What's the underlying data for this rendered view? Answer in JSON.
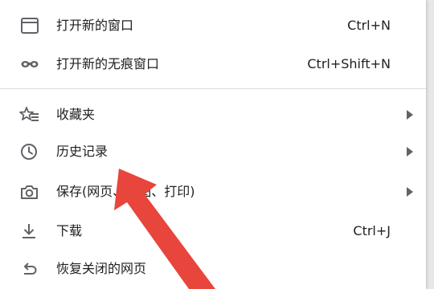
{
  "menu": {
    "items": [
      {
        "label": "打开新的窗口",
        "shortcut": "Ctrl+N",
        "icon": "new-window-icon"
      },
      {
        "label": "打开新的无痕窗口",
        "shortcut": "Ctrl+Shift+N",
        "icon": "incognito-icon"
      },
      {
        "label": "收藏夹",
        "icon": "bookmarks-star-icon",
        "submenu": true
      },
      {
        "label": "历史记录",
        "icon": "history-clock-icon",
        "submenu": true
      },
      {
        "label": "保存(网页、截图、打印)",
        "icon": "camera-icon",
        "submenu": true
      },
      {
        "label": "下载",
        "shortcut": "Ctrl+J",
        "icon": "download-icon"
      },
      {
        "label": "恢复关闭的网页",
        "icon": "restore-icon"
      }
    ]
  },
  "annotation": {
    "arrow_color": "#e8453c",
    "points_to": "历史记录"
  }
}
